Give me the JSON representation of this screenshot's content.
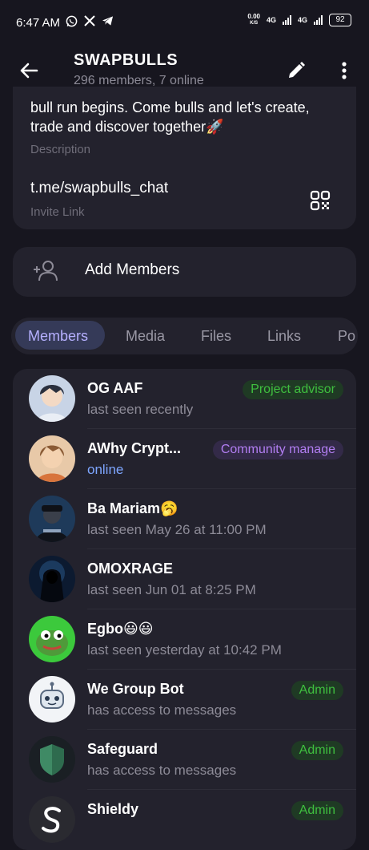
{
  "status_bar": {
    "time": "6:47 AM",
    "net_speed": "0.00",
    "net_unit": "K/S",
    "net1": "4G",
    "net2": "4G",
    "battery": "92"
  },
  "header": {
    "title": "SWAPBULLS",
    "subtitle": "296 members, 7 online"
  },
  "info": {
    "description": "bull run begins. Come bulls and let's create, trade and discover together🚀",
    "description_label": "Description",
    "invite_link": "t.me/swapbulls_chat",
    "invite_label": "Invite Link"
  },
  "add_members": {
    "label": "Add Members"
  },
  "tabs": [
    {
      "label": "Members"
    },
    {
      "label": "Media"
    },
    {
      "label": "Files"
    },
    {
      "label": "Links"
    },
    {
      "label": "Po"
    }
  ],
  "members": [
    {
      "name": "OG AAF",
      "status": "last seen recently",
      "badge": "Project advisor",
      "avatar": "anime-boy-white"
    },
    {
      "name": "AWhy Crypt...",
      "status": "online",
      "badge": "Community manage",
      "avatar": "anime-boy-brown"
    },
    {
      "name": "Ba Mariam🥱",
      "status": "last seen May 26 at 11:00 PM",
      "badge": "",
      "avatar": "cap-man"
    },
    {
      "name": "OMOXRAGE",
      "status": "last seen Jun 01 at 8:25 PM",
      "badge": "",
      "avatar": "hooded-figure"
    },
    {
      "name": "Egbo😃😃",
      "status": "last seen yesterday at 10:42 PM",
      "badge": "",
      "avatar": "pepe-frog"
    },
    {
      "name": "We Group Bot",
      "status": "has access to messages",
      "badge": "Admin",
      "avatar": "robot"
    },
    {
      "name": "Safeguard",
      "status": "has access to messages",
      "badge": "Admin",
      "avatar": "shield"
    },
    {
      "name": "Shieldy",
      "status": "",
      "badge": "Admin",
      "avatar": "shieldy-s"
    }
  ]
}
